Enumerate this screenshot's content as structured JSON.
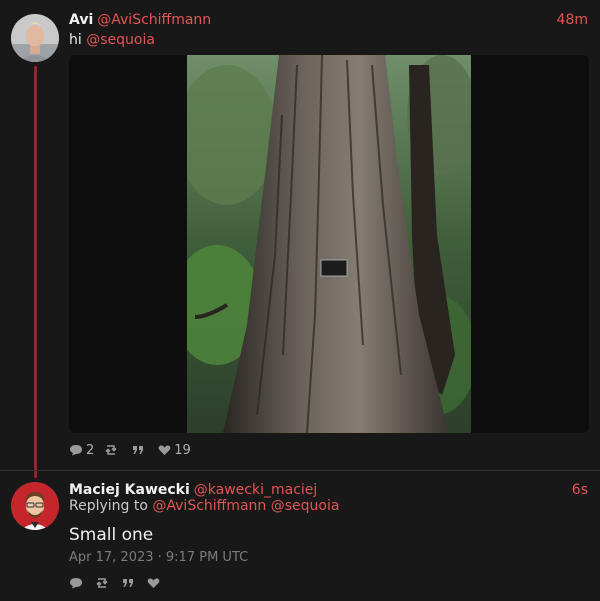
{
  "tweets": [
    {
      "fullname": "Avi",
      "handle": "@AviSchiffmann",
      "time": "48m",
      "text_prefix": "hi ",
      "mention": "@sequoia",
      "media_icon": "tree-trunk-photo",
      "stats": {
        "replies": "2",
        "retweets": "",
        "quotes": "",
        "likes": "19"
      }
    },
    {
      "fullname": "Maciej Kawecki",
      "handle": "@kawecki_maciej",
      "time": "6s",
      "replying_label": "Replying to",
      "replying_to": "@AviSchiffmann @sequoia",
      "text": "Small one",
      "date": "Apr 17, 2023 · 9:17 PM UTC",
      "stats": {
        "replies": "",
        "retweets": "",
        "quotes": "",
        "likes": ""
      }
    }
  ],
  "colors": {
    "background": "#181818",
    "accent": "#e35454",
    "thread_line": "#8a2b2b",
    "muted": "#9a9a9a"
  },
  "icons": [
    "comment-icon",
    "retweet-icon",
    "quote-icon",
    "heart-icon"
  ]
}
